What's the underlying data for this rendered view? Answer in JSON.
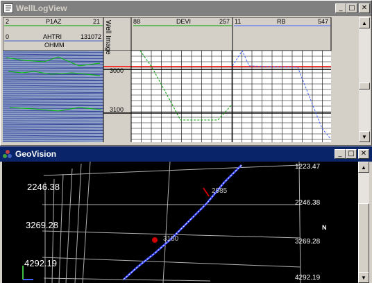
{
  "welllog": {
    "title": "WellLogView",
    "track1": {
      "name": "P1AZ",
      "min": "2",
      "max": "21"
    },
    "track2": {
      "name": "AHTRI",
      "min": "0",
      "max": "131072",
      "unit": "OHMM"
    },
    "image_label": "Well Image",
    "depth_ticks": [
      "3000",
      "3100"
    ],
    "track3": {
      "name": "DEVI",
      "min": "88",
      "max": "257"
    },
    "track4": {
      "name": "RB",
      "min": "11",
      "max": "547"
    },
    "colors": {
      "track1": "#00a000",
      "track2": "#4060c0",
      "devi": "#00a000",
      "rb": "#4060ff",
      "depth_line": "#ff0000"
    }
  },
  "geovision": {
    "title": "GeoVision",
    "labels": {
      "left1": "2246.38",
      "left2": "3269.28",
      "left3": "4292.19",
      "right_top": "1223.47",
      "right_mid": "2246.38",
      "right_low": "3269.28",
      "right_bottom": "4292.19",
      "depth_upper": "2985",
      "depth_lower": "3150",
      "north": "N"
    }
  },
  "window_controls": {
    "minimize": "_",
    "maximize": "□",
    "close": "✕"
  },
  "scroll": {
    "up": "▲",
    "down": "▼"
  }
}
